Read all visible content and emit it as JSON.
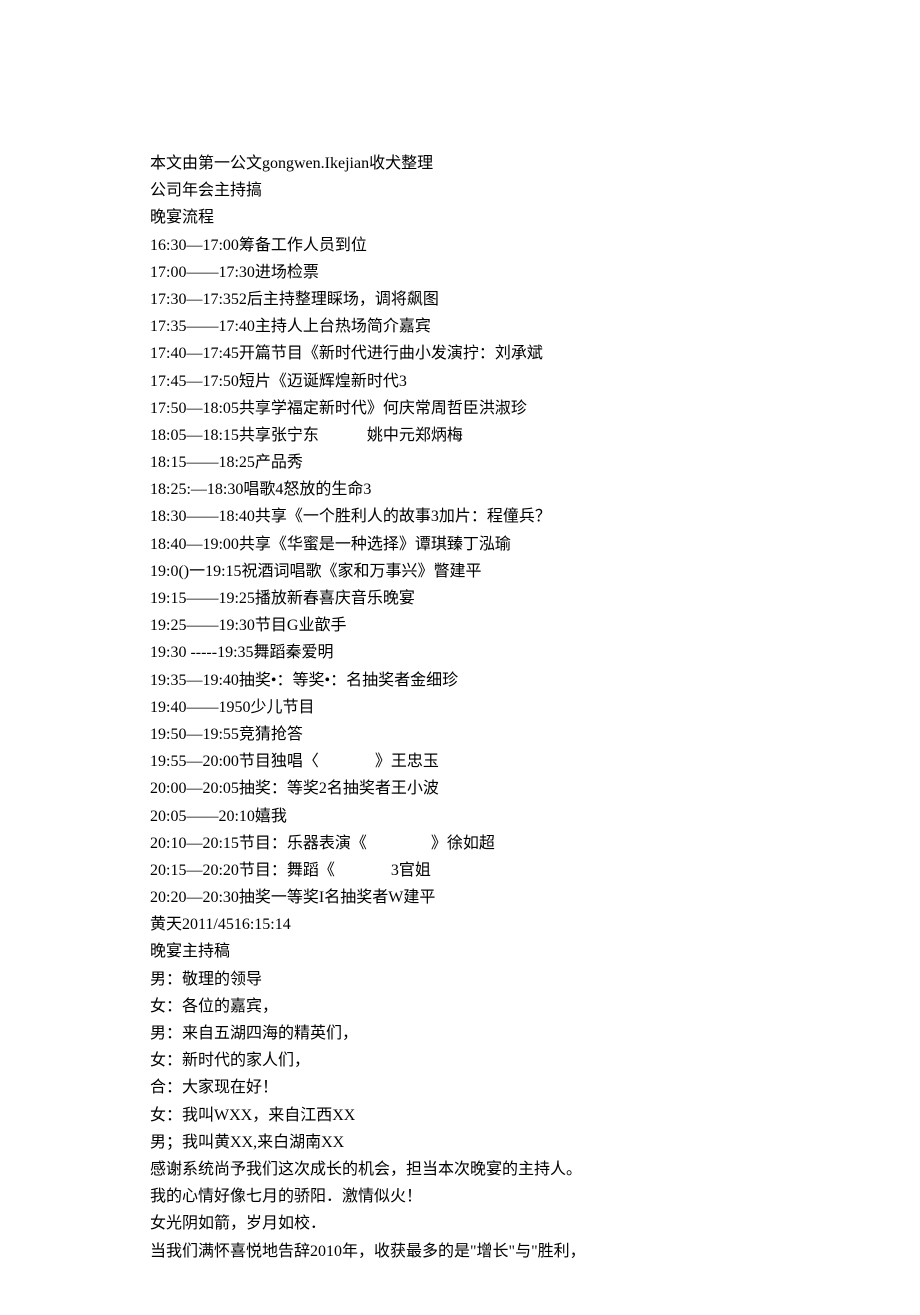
{
  "lines": [
    "本文由第一公文gongwen.Ikejian收犬整理",
    "公司年会主持搞",
    "晚宴流程",
    "16:30—17:00筹备工作人员到位",
    "17:00——17:30进场检票",
    "17:30—17:352后主持整理睬场，调将飙图",
    "17:35——17:40主持人上台热场简介嘉宾",
    "17:40—17:45开篇节目《新时代进行曲小发演拧：刘承斌",
    "17:45—17:50短片《迈诞辉煌新时代3",
    "17:50—18:05共享学福定新时代》何庆常周哲臣洪淑珍",
    "18:05—18:15共享张宁东            姚中元郑炳梅",
    "18:15——18:25产品秀",
    "18:25:—18:30唱歌4怒放的生命3",
    "18:30——18:40共享《一个胜利人的故事3加片：程僮兵？",
    "18:40—19:00共享《华蜜是一种选择》谭琪臻丁泓瑜",
    "19:0()一19:15祝酒词唱歌《家和万事兴》瞥建平",
    "19:15——19:25播放新春喜庆音乐晚宴",
    "19:25——19:30节目G业歆手",
    "19:30 -----19:35舞蹈秦爱明",
    "19:35—19:40抽奖•：等奖•：名抽奖者金细珍",
    "19:40——1950少儿节目",
    "19:50—19:55竞猜抢答",
    "19:55—20:00节目独唱〈              》王忠玉",
    "20:00—20:05抽奖：等奖2名抽奖者王小波",
    "20:05——20:10嬉我",
    "20:10—20:15节目：乐器表演《                》徐如超",
    "20:15—20:20节目：舞蹈《              3官姐",
    "20:20—20:30抽奖一等奖I名抽奖者W建平",
    "黄天2011/4516:15:14",
    "晚宴主持稿",
    "男：敬理的领导",
    "女：各位的嘉宾，",
    "男：来自五湖四海的精英们，",
    "女：新时代的家人们，",
    "合：大家现在好！",
    "女：我叫WXX，来自江西XX",
    "男；我叫黄XX,来白湖南XX",
    "感谢系统尚予我们这次成长的机会，担当本次晚宴的主持人。",
    "我的心情好像七月的骄阳．激情似火！",
    "女光阴如箭，岁月如校．",
    "当我们满怀喜悦地告辞2010年，收获最多的是\"增长\"与\"胜利，"
  ]
}
